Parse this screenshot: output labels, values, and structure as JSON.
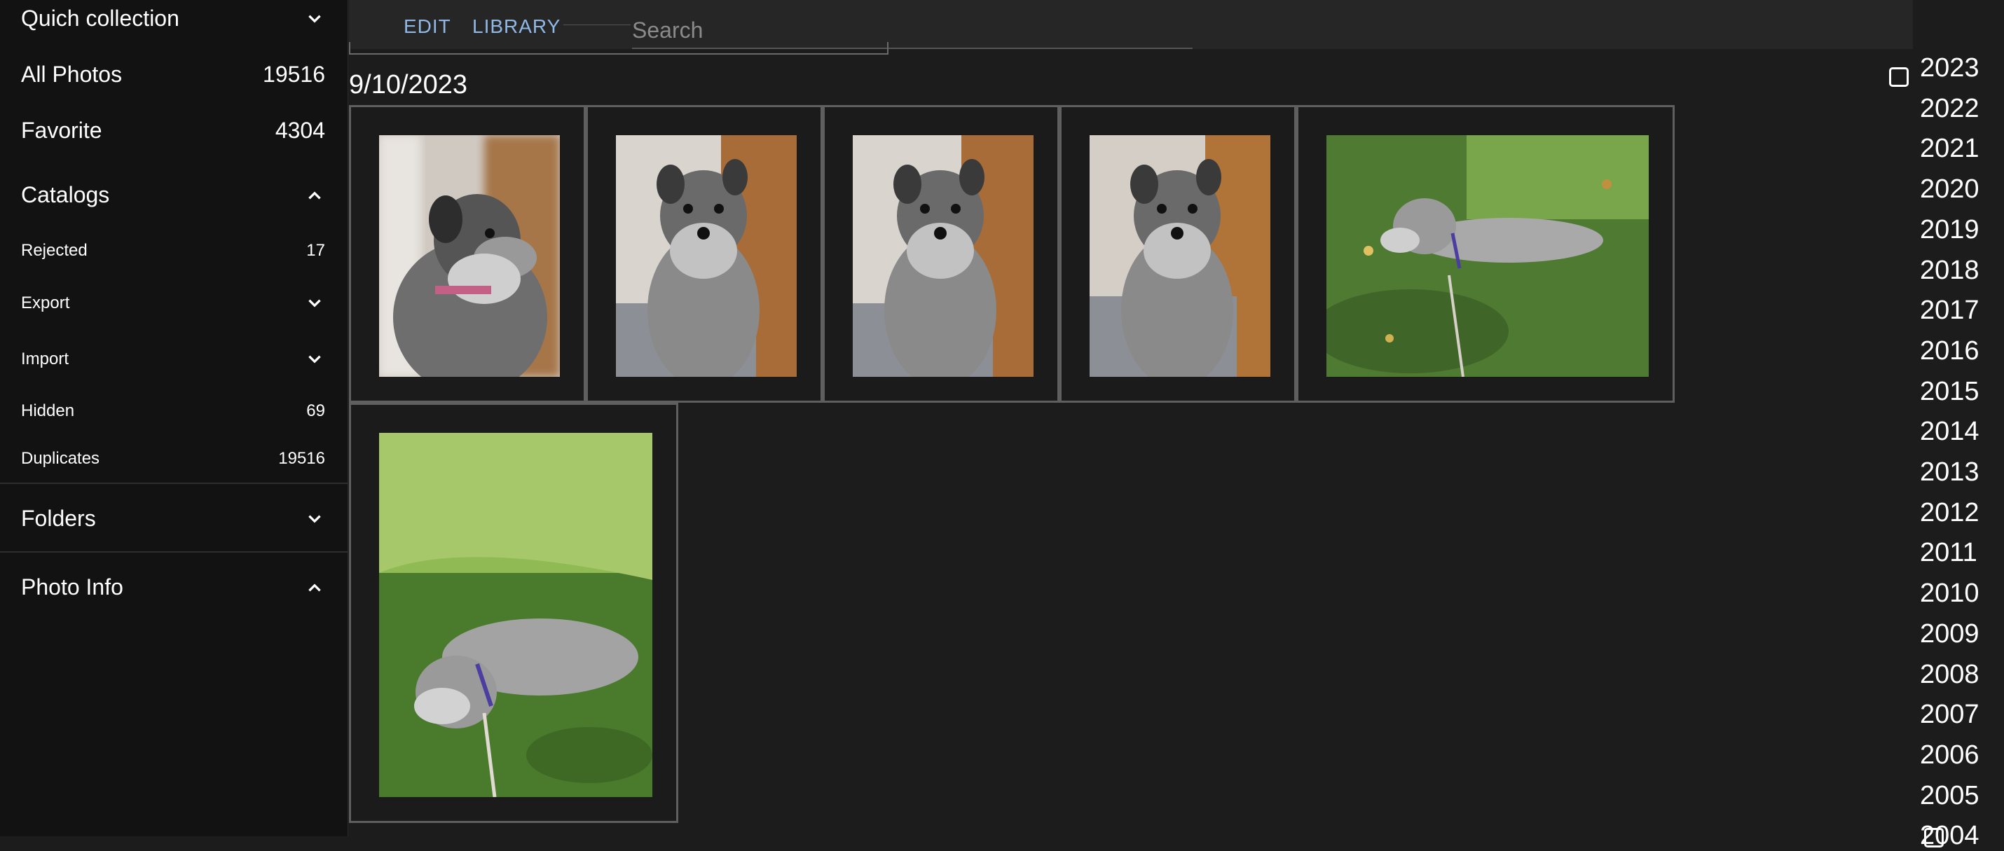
{
  "sidebar": {
    "quick_collection": "Quich collection",
    "all_photos": {
      "label": "All Photos",
      "count": "19516"
    },
    "favorite": {
      "label": "Favorite",
      "count": "4304"
    },
    "catalogs": "Catalogs",
    "rejected": {
      "label": "Rejected",
      "count": "17"
    },
    "export": "Export",
    "import": "Import",
    "hidden": {
      "label": "Hidden",
      "count": "69"
    },
    "duplicates": {
      "label": "Duplicates",
      "count": "19516"
    },
    "folders": "Folders",
    "photo_info": "Photo Info"
  },
  "toolbar": {
    "edit": "EDIT",
    "library": "LIBRARY",
    "search_placeholder": "Search"
  },
  "gallery": {
    "date": "9/10/2023"
  },
  "years": [
    "2023",
    "2022",
    "2021",
    "2020",
    "2019",
    "2018",
    "2017",
    "2016",
    "2015",
    "2014",
    "2013",
    "2012",
    "2011",
    "2010",
    "2009",
    "2008",
    "2007",
    "2006",
    "2005",
    "2004"
  ],
  "colors": {
    "accent": "#8fb8e6",
    "background": "#1c1c1c",
    "sidebar": "#121212"
  }
}
